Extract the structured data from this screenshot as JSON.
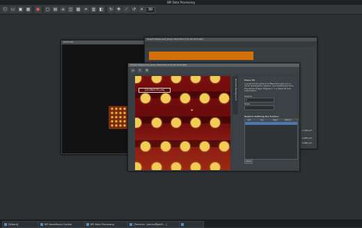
{
  "app_title": "BPI Data Processing",
  "toolbar": {
    "zoom_value": "30",
    "icons": [
      "cube-icon",
      "folder-icon",
      "save-icon",
      "grid-icon",
      "record-icon",
      "photo-icon",
      "table-icon",
      "list-icon",
      "clip-icon",
      "image-icon",
      "crop-icon",
      "calc-icon",
      "layers-icon",
      "rotate-icon",
      "move-icon",
      "ruler-icon",
      "chart-icon",
      "sheet-icon",
      "path-icon",
      "rotate-ccw-icon",
      "scale-icon"
    ]
  },
  "overview": {
    "title": "Overview"
  },
  "back_window": {
    "title": "Height (Measured) [Scan 2024-05-13 01:42:16 M pbt]",
    "numbers": [
      "1.000 µm",
      "0.883 µm",
      "0.881 µm"
    ]
  },
  "front_window": {
    "title": "Height (Measured) [Scan 2024-05-13 01:42:16 M pbt]",
    "measure_label": "[10.08x3.35 µm]",
    "panel": {
      "side_tab": "Remove Background",
      "section": "Plane Fit",
      "description": "A polynomial surface is fitted through one or more rectangular regions, and subtracted from the whole image. Degree 1 = a plane fit and subtraction.",
      "degree_label": "Degree",
      "degree_value": "1",
      "mode_label": "Mode",
      "regions_title": "Regions Defining the Surface",
      "table_headers": [
        "Left",
        "Top",
        "Right",
        "Bottom"
      ],
      "clear_label": "Clear"
    }
  },
  "taskbar": {
    "items": [
      {
        "label": "[Wizard]"
      },
      {
        "label": "BPI NanoMount Control"
      },
      {
        "label": "BPI Data Processing"
      },
      {
        "label": "[Terminal - pierrez@pbt5 ...]"
      },
      {
        "label": ""
      }
    ]
  }
}
